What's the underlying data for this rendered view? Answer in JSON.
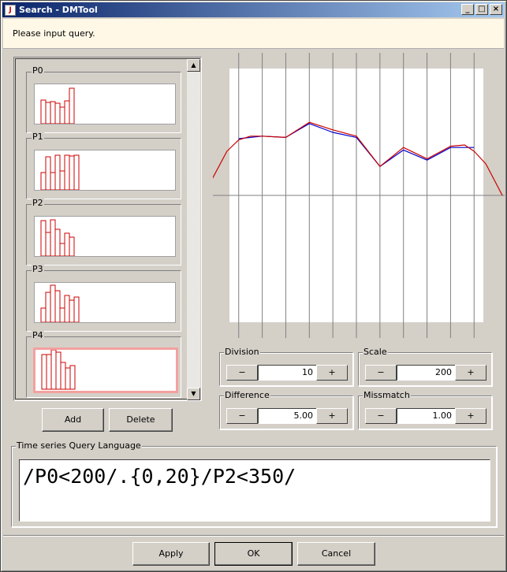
{
  "window": {
    "title": "Search - DMTool",
    "minimize": "_",
    "maximize": "□",
    "close": "×"
  },
  "info": {
    "message": "Please input query."
  },
  "patterns": [
    {
      "label": "P0",
      "values": [
        30,
        27,
        28,
        26,
        21,
        29,
        45
      ],
      "selected": false
    },
    {
      "label": "P1",
      "values": [
        22,
        42,
        22,
        44,
        24,
        44,
        43,
        44
      ],
      "selected": false
    },
    {
      "label": "P2",
      "values": [
        45,
        30,
        46,
        34,
        16,
        29,
        24
      ],
      "selected": false
    },
    {
      "label": "P3",
      "values": [
        18,
        38,
        47,
        40,
        18,
        34,
        28,
        32
      ],
      "selected": false
    },
    {
      "label": "P4",
      "values": [
        44,
        44,
        50,
        47,
        34,
        27,
        30
      ],
      "selected": true
    }
  ],
  "buttons": {
    "add": "Add",
    "delete": "Delete",
    "apply": "Apply",
    "ok": "OK",
    "cancel": "Cancel"
  },
  "controls": {
    "division": {
      "label": "Division",
      "value": "10",
      "minus": "−",
      "plus": "+"
    },
    "scale": {
      "label": "Scale",
      "value": "200",
      "minus": "−",
      "plus": "+"
    },
    "difference": {
      "label": "Difference",
      "value": "5.00",
      "minus": "−",
      "plus": "+"
    },
    "missmatch": {
      "label": "Missmatch",
      "value": "1.00",
      "minus": "−",
      "plus": "+"
    }
  },
  "query": {
    "group_label": "Time series Query Language",
    "text": "/P0<200/.{0,20}/P2<350/"
  },
  "chart_data": {
    "type": "line",
    "divisions": 10,
    "grid": true,
    "ylim": [
      -1,
      1
    ],
    "series": [
      {
        "color": "#0000cc",
        "x": [
          0,
          1,
          2,
          3,
          4,
          5,
          6,
          7,
          8,
          9,
          10
        ],
        "y": [
          0.45,
          0.47,
          0.46,
          0.57,
          0.5,
          0.46,
          0.23,
          0.36,
          0.28,
          0.38,
          0.38
        ]
      },
      {
        "color": "#cc0000",
        "x": [
          -1.5,
          -0.5,
          0,
          0.5,
          1,
          2,
          3,
          4,
          5,
          6,
          7,
          8,
          9,
          9.6,
          10,
          10.5,
          11.2
        ],
        "y": [
          0,
          0.35,
          0.44,
          0.47,
          0.47,
          0.46,
          0.58,
          0.52,
          0.47,
          0.23,
          0.38,
          0.29,
          0.39,
          0.4,
          0.35,
          0.25,
          0.0
        ]
      }
    ]
  }
}
